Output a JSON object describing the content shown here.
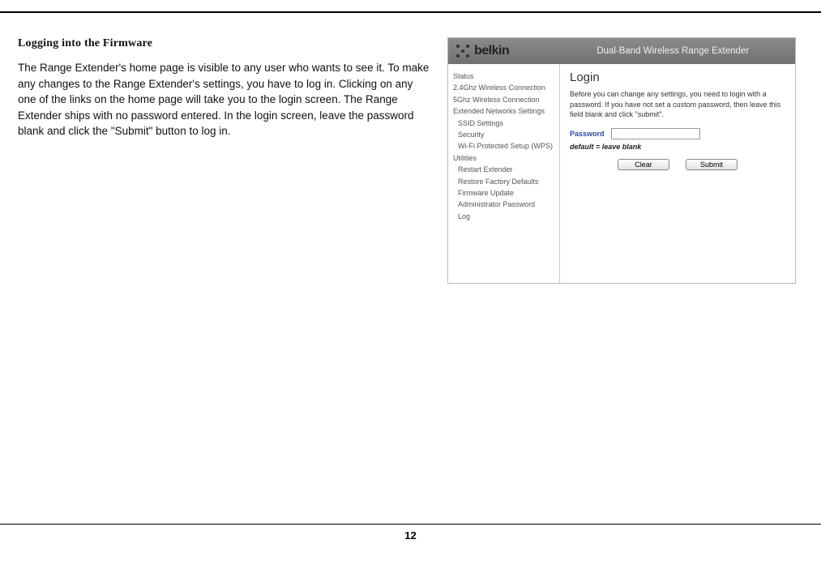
{
  "doc": {
    "section_title": "Logging into the Firmware",
    "body": "The Range Extender's home page is visible to any user who wants to see it. To make any changes to the Range Extender's settings, you have to log in. Clicking on any one of the links on the home page will take you to the login screen. The Range Extender ships with no password entered. In the login screen, leave the password blank and click the \"Submit\" button to log in.",
    "page_number": "12"
  },
  "router": {
    "brand": "belkin",
    "header_title": "Dual-Band Wireless Range Extender",
    "sidebar": {
      "items": [
        {
          "label": "Status",
          "indent": 0
        },
        {
          "label": "2.4Ghz Wireless Connection",
          "indent": 0
        },
        {
          "label": "5Ghz Wireless Connection",
          "indent": 0
        },
        {
          "label": "Extended Networks Settings",
          "indent": 0
        },
        {
          "label": "SSID Settings",
          "indent": 1
        },
        {
          "label": "Security",
          "indent": 1
        },
        {
          "label": "Wi-Fi Protected Setup (WPS)",
          "indent": 1
        },
        {
          "label": "Utilities",
          "indent": 0
        },
        {
          "label": "Restart Extender",
          "indent": 1
        },
        {
          "label": "Restore Factory Defaults",
          "indent": 1
        },
        {
          "label": "Firmware Update",
          "indent": 1
        },
        {
          "label": "Administrator Password",
          "indent": 1
        },
        {
          "label": "Log",
          "indent": 1
        }
      ]
    },
    "login": {
      "title": "Login",
      "desc": "Before you can change any settings, you need to login with a password. If you have not set a custom password, then leave this field blank and click \"submit\".",
      "password_label": "Password",
      "password_value": "",
      "default_note": "default = leave blank",
      "clear_label": "Clear",
      "submit_label": "Submit"
    }
  }
}
